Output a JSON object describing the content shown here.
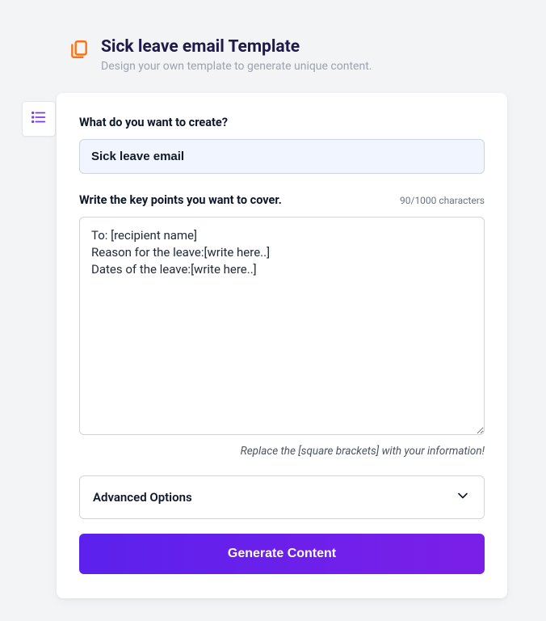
{
  "header": {
    "title": "Sick leave email Template",
    "subtitle": "Design your own template to generate unique content."
  },
  "form": {
    "title_label": "What do you want to create?",
    "title_value": "Sick leave email",
    "keypoints_label": "Write the key points you want to cover.",
    "char_count": "90/1000 characters",
    "keypoints_value": "To: [recipient name]\nReason for the leave:[write here..]\nDates of the leave:[write here..]",
    "helper": "Replace the [square brackets] with your information!",
    "advanced_label": "Advanced Options",
    "generate_label": "Generate Content"
  }
}
